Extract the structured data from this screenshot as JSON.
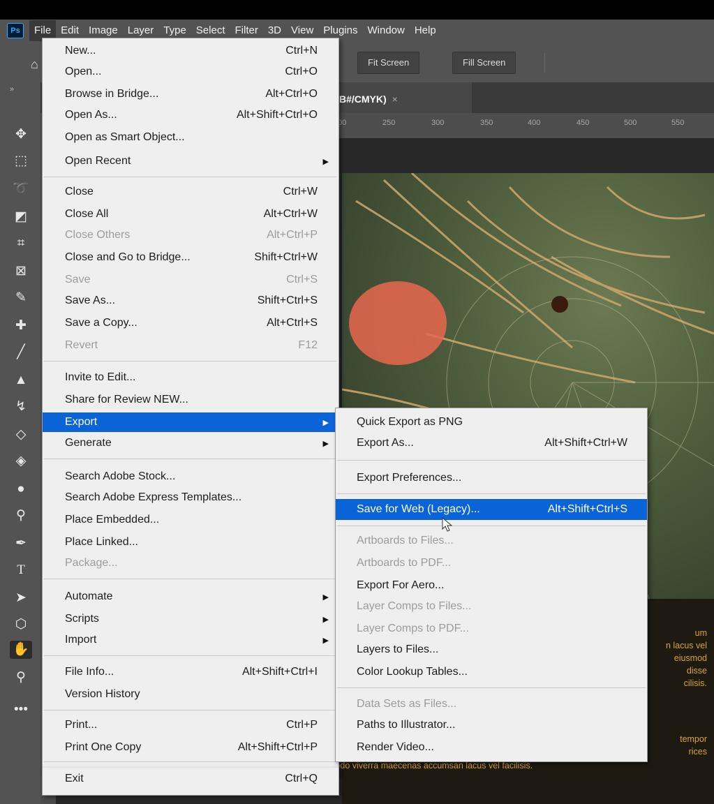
{
  "app": {
    "logo": "Ps"
  },
  "menubar": {
    "items": [
      "File",
      "Edit",
      "Image",
      "Layer",
      "Type",
      "Select",
      "Filter",
      "3D",
      "View",
      "Plugins",
      "Window",
      "Help"
    ]
  },
  "options_bar": {
    "fit_screen": "Fit Screen",
    "fill_screen": "Fill Screen"
  },
  "document": {
    "tab_title": "B#/CMYK)",
    "tab_close": "×",
    "ruler_ticks": [
      "00",
      "250",
      "300",
      "350",
      "400",
      "450",
      "500",
      "550"
    ],
    "text_lines_right": [
      "um",
      "n lacus vel",
      "eiusmod",
      "disse",
      "cilisis."
    ],
    "text_lines_bottom": [
      "tempor",
      "rices"
    ],
    "text_last": "modo viverra maecenas accumsan lacus vel facilisis."
  },
  "file_menu": {
    "items": [
      {
        "label": "New...",
        "shortcut": "Ctrl+N"
      },
      {
        "label": "Open...",
        "shortcut": "Ctrl+O"
      },
      {
        "label": "Browse in Bridge...",
        "shortcut": "Alt+Ctrl+O"
      },
      {
        "label": "Open As...",
        "shortcut": "Alt+Shift+Ctrl+O"
      },
      {
        "label": "Open as Smart Object...",
        "shortcut": ""
      },
      {
        "label": "Open Recent",
        "shortcut": "",
        "submenu": true
      },
      {
        "label": "Close",
        "shortcut": "Ctrl+W"
      },
      {
        "label": "Close All",
        "shortcut": "Alt+Ctrl+W"
      },
      {
        "label": "Close Others",
        "shortcut": "Alt+Ctrl+P",
        "disabled": true
      },
      {
        "label": "Close and Go to Bridge...",
        "shortcut": "Shift+Ctrl+W"
      },
      {
        "label": "Save",
        "shortcut": "Ctrl+S",
        "disabled": true
      },
      {
        "label": "Save As...",
        "shortcut": "Shift+Ctrl+S"
      },
      {
        "label": "Save a Copy...",
        "shortcut": "Alt+Ctrl+S"
      },
      {
        "label": "Revert",
        "shortcut": "F12",
        "disabled": true
      },
      {
        "label": "Invite to Edit...",
        "shortcut": ""
      },
      {
        "label": "Share for Review NEW...",
        "shortcut": ""
      },
      {
        "label": "Export",
        "shortcut": "",
        "submenu": true,
        "highlighted": true
      },
      {
        "label": "Generate",
        "shortcut": "",
        "submenu": true
      },
      {
        "label": "Search Adobe Stock...",
        "shortcut": ""
      },
      {
        "label": "Search Adobe Express Templates...",
        "shortcut": ""
      },
      {
        "label": "Place Embedded...",
        "shortcut": ""
      },
      {
        "label": "Place Linked...",
        "shortcut": ""
      },
      {
        "label": "Package...",
        "shortcut": "",
        "disabled": true
      },
      {
        "label": "Automate",
        "shortcut": "",
        "submenu": true
      },
      {
        "label": "Scripts",
        "shortcut": "",
        "submenu": true
      },
      {
        "label": "Import",
        "shortcut": "",
        "submenu": true
      },
      {
        "label": "File Info...",
        "shortcut": "Alt+Shift+Ctrl+I"
      },
      {
        "label": "Version History",
        "shortcut": ""
      },
      {
        "label": "Print...",
        "shortcut": "Ctrl+P"
      },
      {
        "label": "Print One Copy",
        "shortcut": "Alt+Shift+Ctrl+P"
      },
      {
        "label": "Exit",
        "shortcut": "Ctrl+Q"
      }
    ]
  },
  "export_menu": {
    "items": [
      {
        "label": "Quick Export as PNG",
        "shortcut": ""
      },
      {
        "label": "Export As...",
        "shortcut": "Alt+Shift+Ctrl+W"
      },
      {
        "label": "Export Preferences...",
        "shortcut": ""
      },
      {
        "label": "Save for Web (Legacy)...",
        "shortcut": "Alt+Shift+Ctrl+S",
        "highlighted": true
      },
      {
        "label": "Artboards to Files...",
        "shortcut": "",
        "disabled": true
      },
      {
        "label": "Artboards to PDF...",
        "shortcut": "",
        "disabled": true
      },
      {
        "label": "Export For Aero...",
        "shortcut": ""
      },
      {
        "label": "Layer Comps to Files...",
        "shortcut": "",
        "disabled": true
      },
      {
        "label": "Layer Comps to PDF...",
        "shortcut": "",
        "disabled": true
      },
      {
        "label": "Layers to Files...",
        "shortcut": ""
      },
      {
        "label": "Color Lookup Tables...",
        "shortcut": ""
      },
      {
        "label": "Data Sets as Files...",
        "shortcut": "",
        "disabled": true
      },
      {
        "label": "Paths to Illustrator...",
        "shortcut": ""
      },
      {
        "label": "Render Video...",
        "shortcut": ""
      }
    ]
  },
  "colors": {
    "highlight": "#0a64d8",
    "menu_bg": "#efefef",
    "doc_text": "#d8a72a"
  }
}
